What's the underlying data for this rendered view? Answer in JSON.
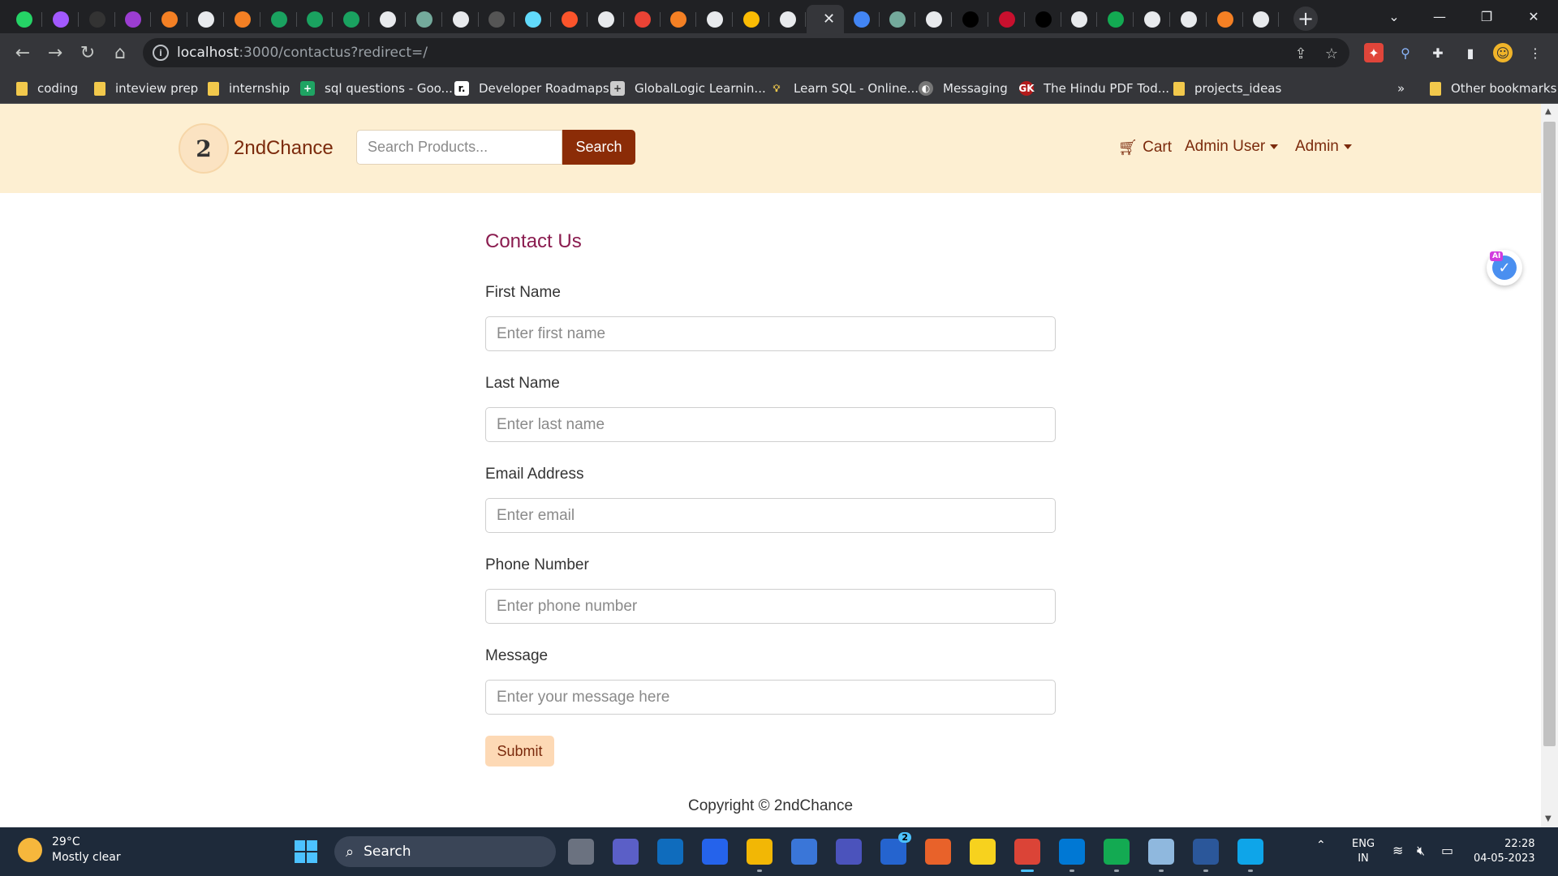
{
  "browser": {
    "tabs_count_icons": [
      "whatsapp",
      "figma",
      "github",
      "u-ext",
      "stackoverflow",
      "chrome",
      "stackoverflow",
      "codecov",
      "codecov",
      "wikipedia",
      "chrome",
      "chatgpt",
      "google",
      "bottle",
      "react",
      "brave",
      "chrome",
      "gmail",
      "stackoverflow",
      "chrome",
      "keep",
      "google",
      "active",
      "docs",
      "chatgpt",
      "google",
      "hbr",
      "mc",
      "hbr",
      "google",
      "mongo",
      "google",
      "google",
      "stackoverflow",
      "google"
    ],
    "url_host": "localhost",
    "url_rest": ":3000/contactus?redirect=/",
    "bookmarks": [
      {
        "label": "coding",
        "icon": "folder-icon"
      },
      {
        "label": "inteview prep",
        "icon": "folder-icon"
      },
      {
        "label": "internship",
        "icon": "folder-icon"
      },
      {
        "label": "sql questions - Goo...",
        "icon": "sheets-icon"
      },
      {
        "label": "Developer Roadmaps",
        "icon": "roadmap-icon"
      },
      {
        "label": "GlobalLogic Learnin...",
        "icon": "globallogic-icon"
      },
      {
        "label": "Learn SQL - Online...",
        "icon": "bulb-icon"
      },
      {
        "label": "Messaging",
        "icon": "globe-icon"
      },
      {
        "label": "The Hindu PDF Tod...",
        "icon": "gk-icon"
      },
      {
        "label": "projects_ideas",
        "icon": "folder-icon"
      }
    ],
    "bookmarks_overflow": "»",
    "other_bookmarks": "Other bookmarks"
  },
  "site": {
    "brand": "2ndChance",
    "logo_text": "2",
    "search_placeholder": "Search Products...",
    "search_button": "Search",
    "nav": {
      "cart": "Cart",
      "user": "Admin User",
      "admin": "Admin"
    }
  },
  "form": {
    "title": "Contact Us",
    "fields": [
      {
        "label": "First Name",
        "placeholder": "Enter first name"
      },
      {
        "label": "Last Name",
        "placeholder": "Enter last name"
      },
      {
        "label": "Email Address",
        "placeholder": "Enter email"
      },
      {
        "label": "Phone Number",
        "placeholder": "Enter phone number"
      },
      {
        "label": "Message",
        "placeholder": "Enter your message here"
      }
    ],
    "submit": "Submit"
  },
  "footer": {
    "copyright": "Copyright © 2ndChance"
  },
  "widget": {
    "tag": "AI"
  },
  "taskbar": {
    "weather_temp": "29°C",
    "weather_desc": "Mostly clear",
    "search_label": "Search",
    "lang_1": "ENG",
    "lang_2": "IN",
    "time": "22:28",
    "date": "04-05-2023",
    "badge": "2"
  },
  "colors": {
    "navbar_bg": "#fdefd2",
    "brand": "#7b2a0c",
    "search_button": "#8b2c07",
    "title": "#8a1c4f",
    "submit_bg": "#fdd9b5"
  }
}
